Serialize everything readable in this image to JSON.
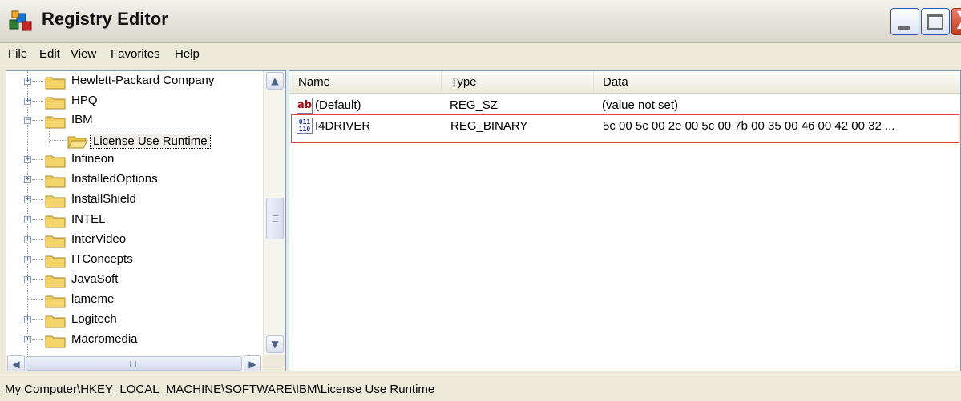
{
  "window": {
    "title": "Registry Editor",
    "icon": "registry-cubes-icon",
    "controls": [
      "minimize-icon",
      "maximize-icon",
      "close-icon"
    ],
    "close_glyph": "X"
  },
  "menu": [
    "File",
    "Edit",
    "View",
    "Favorites",
    "Help"
  ],
  "tree": {
    "items": [
      {
        "label": "Hewlett-Packard Company",
        "expander": "+",
        "level": 1,
        "state": "collapsed"
      },
      {
        "label": "HPQ",
        "expander": "+",
        "level": 1,
        "state": "collapsed"
      },
      {
        "label": "IBM",
        "expander": "−",
        "level": 1,
        "state": "expanded"
      },
      {
        "label": "License Use Runtime",
        "expander": "",
        "level": 2,
        "state": "selected"
      },
      {
        "label": "Infineon",
        "expander": "+",
        "level": 1,
        "state": "collapsed"
      },
      {
        "label": "InstalledOptions",
        "expander": "+",
        "level": 1,
        "state": "collapsed"
      },
      {
        "label": "InstallShield",
        "expander": "+",
        "level": 1,
        "state": "collapsed"
      },
      {
        "label": "INTEL",
        "expander": "+",
        "level": 1,
        "state": "collapsed"
      },
      {
        "label": "InterVideo",
        "expander": "+",
        "level": 1,
        "state": "collapsed"
      },
      {
        "label": "ITConcepts",
        "expander": "+",
        "level": 1,
        "state": "collapsed"
      },
      {
        "label": "JavaSoft",
        "expander": "+",
        "level": 1,
        "state": "collapsed"
      },
      {
        "label": "lameme",
        "expander": "",
        "level": 1,
        "state": "leaf"
      },
      {
        "label": "Logitech",
        "expander": "+",
        "level": 1,
        "state": "collapsed"
      },
      {
        "label": "Macromedia",
        "expander": "+",
        "level": 1,
        "state": "collapsed"
      }
    ],
    "scroll_up_glyph": "▲",
    "scroll_down_glyph": "▼",
    "scroll_left_glyph": "◀",
    "scroll_right_glyph": "▶"
  },
  "list": {
    "columns": [
      "Name",
      "Type",
      "Data"
    ],
    "rows": [
      {
        "icon": "string-value-icon",
        "icon_text": "ab",
        "name": "(Default)",
        "type": "REG_SZ",
        "data": "(value not set)",
        "highlighted": false
      },
      {
        "icon": "binary-value-icon",
        "icon_text": "011 110",
        "name": "I4DRIVER",
        "type": "REG_BINARY",
        "data": "5c 00 5c 00 2e 00 5c 00 7b 00 35 00 46 00 42 00 32 ...",
        "highlighted": true
      }
    ]
  },
  "status": {
    "path": "My Computer\\HKEY_LOCAL_MACHINE\\SOFTWARE\\IBM\\License Use Runtime"
  },
  "colors": {
    "highlight_border": "#e0443a",
    "window_frame": "#ece9d8",
    "close_button": "#c33a1d"
  }
}
